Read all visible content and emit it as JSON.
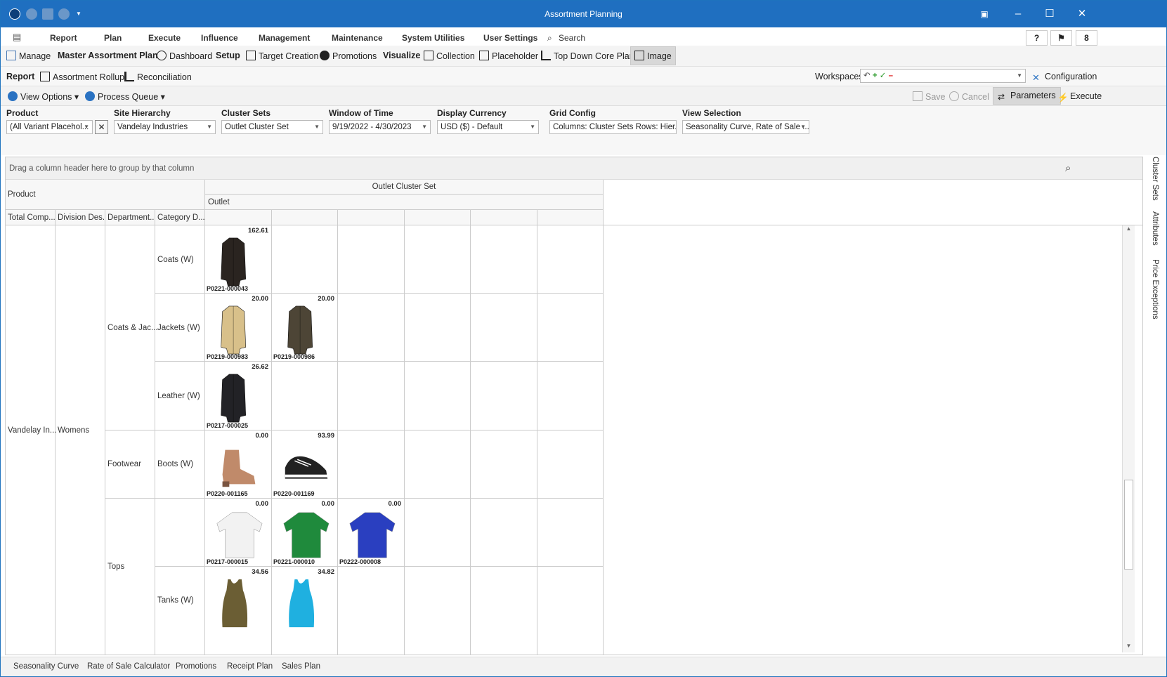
{
  "app": {
    "title": "Assortment Planning",
    "notif_count": "8"
  },
  "menu": [
    "Report",
    "Plan",
    "Execute",
    "Influence",
    "Management",
    "Maintenance",
    "System Utilities",
    "User Settings",
    "Search"
  ],
  "toolbar1": {
    "manage": "Manage",
    "master": "Master Assortment Plan",
    "dashboard": "Dashboard",
    "setup": "Setup",
    "target": "Target Creation",
    "promotions": "Promotions",
    "visualize": "Visualize",
    "collection": "Collection",
    "placeholder": "Placeholder",
    "topdown": "Top Down Core Plan",
    "image": "Image"
  },
  "toolbar2": {
    "report": "Report",
    "rollup": "Assortment Rollup",
    "recon": "Reconciliation",
    "workspaces": "Workspaces",
    "config": "Configuration"
  },
  "toolbar3": {
    "view_options": "View Options",
    "process_queue": "Process Queue",
    "save": "Save",
    "cancel": "Cancel",
    "parameters": "Parameters",
    "execute": "Execute"
  },
  "params": {
    "product_label": "Product",
    "product_value": "(All Variant Placehol...",
    "site_label": "Site Hierarchy",
    "site_value": "Vandelay Industries",
    "cluster_label": "Cluster Sets",
    "cluster_value": "Outlet Cluster Set",
    "window_label": "Window of Time",
    "window_value": "9/19/2022 - 4/30/2023",
    "currency_label": "Display Currency",
    "currency_value": "USD ($) - Default",
    "grid_label": "Grid Config",
    "grid_value": "Columns: Cluster Sets Rows: Hier...",
    "view_label": "View Selection",
    "view_value": "Seasonality Curve, Rate of Sale ..."
  },
  "grid": {
    "group_hint": "Drag a column header here to group by that column",
    "band_product": "Product",
    "band_cluster": "Outlet Cluster Set",
    "band_outlet": "Outlet",
    "col_total": "Total Comp...",
    "col_division": "Division Des...",
    "col_dept": "Department...",
    "col_category": "Category D...",
    "total_value": "Vandelay In...",
    "division_value": "Womens",
    "dept_coats": "Coats & Jac...",
    "dept_footwear": "Footwear",
    "dept_tops": "Tops",
    "cat_coats": "Coats (W)",
    "cat_jackets": "Jackets (W)",
    "cat_leather": "Leather (W)",
    "cat_boots": "Boots (W)",
    "cat_tops": "",
    "cat_tanks": "Tanks (W)",
    "products": [
      {
        "row": 0,
        "col": 0,
        "value": "162.61",
        "code": "P0221-000043",
        "kind": "coat",
        "color": "#2a2420"
      },
      {
        "row": 1,
        "col": 0,
        "value": "20.00",
        "code": "P0219-000983",
        "kind": "coat",
        "color": "#d8c08a"
      },
      {
        "row": 1,
        "col": 1,
        "value": "20.00",
        "code": "P0219-000986",
        "kind": "coat",
        "color": "#4d4536"
      },
      {
        "row": 2,
        "col": 0,
        "value": "26.62",
        "code": "P0217-000025",
        "kind": "coat",
        "color": "#222226"
      },
      {
        "row": 3,
        "col": 0,
        "value": "0.00",
        "code": "P0220-001165",
        "kind": "boot",
        "color": "#c08a6a"
      },
      {
        "row": 3,
        "col": 1,
        "value": "93.99",
        "code": "P0220-001169",
        "kind": "shoe",
        "color": "#222"
      },
      {
        "row": 4,
        "col": 0,
        "value": "0.00",
        "code": "P0217-000015",
        "kind": "top",
        "color": "#f2f2f2"
      },
      {
        "row": 4,
        "col": 1,
        "value": "0.00",
        "code": "P0221-000010",
        "kind": "top",
        "color": "#1f8a3c"
      },
      {
        "row": 4,
        "col": 2,
        "value": "0.00",
        "code": "P0222-000008",
        "kind": "top",
        "color": "#2a3fc0"
      },
      {
        "row": 5,
        "col": 0,
        "value": "34.56",
        "code": "",
        "kind": "tank",
        "color": "#6b5e34"
      },
      {
        "row": 5,
        "col": 1,
        "value": "34.82",
        "code": "",
        "kind": "tank",
        "color": "#1fb0e0"
      }
    ]
  },
  "sidetabs": [
    "Cluster Sets",
    "Attributes",
    "Price Exceptions"
  ],
  "bottomtabs": [
    "Seasonality Curve",
    "Rate of Sale Calculator",
    "Promotions",
    "Receipt Plan",
    "Sales Plan"
  ]
}
